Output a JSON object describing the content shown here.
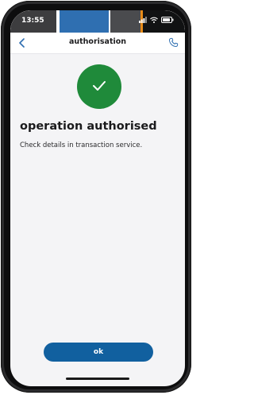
{
  "status_bar": {
    "time": "13:55",
    "icons": [
      "signal-icon",
      "wifi-icon",
      "battery-icon"
    ]
  },
  "header": {
    "title": "authorisation",
    "back_icon": "chevron-left-icon",
    "call_icon": "phone-icon"
  },
  "main": {
    "status_icon": "checkmark-icon",
    "title": "operation authorised",
    "subtitle": "Check details in transaction service."
  },
  "footer": {
    "ok_label": "ok"
  },
  "colors": {
    "success": "#1f8a3a",
    "primary": "#11609f",
    "accent": "#2f6fb1",
    "background": "#f4f4f6"
  }
}
